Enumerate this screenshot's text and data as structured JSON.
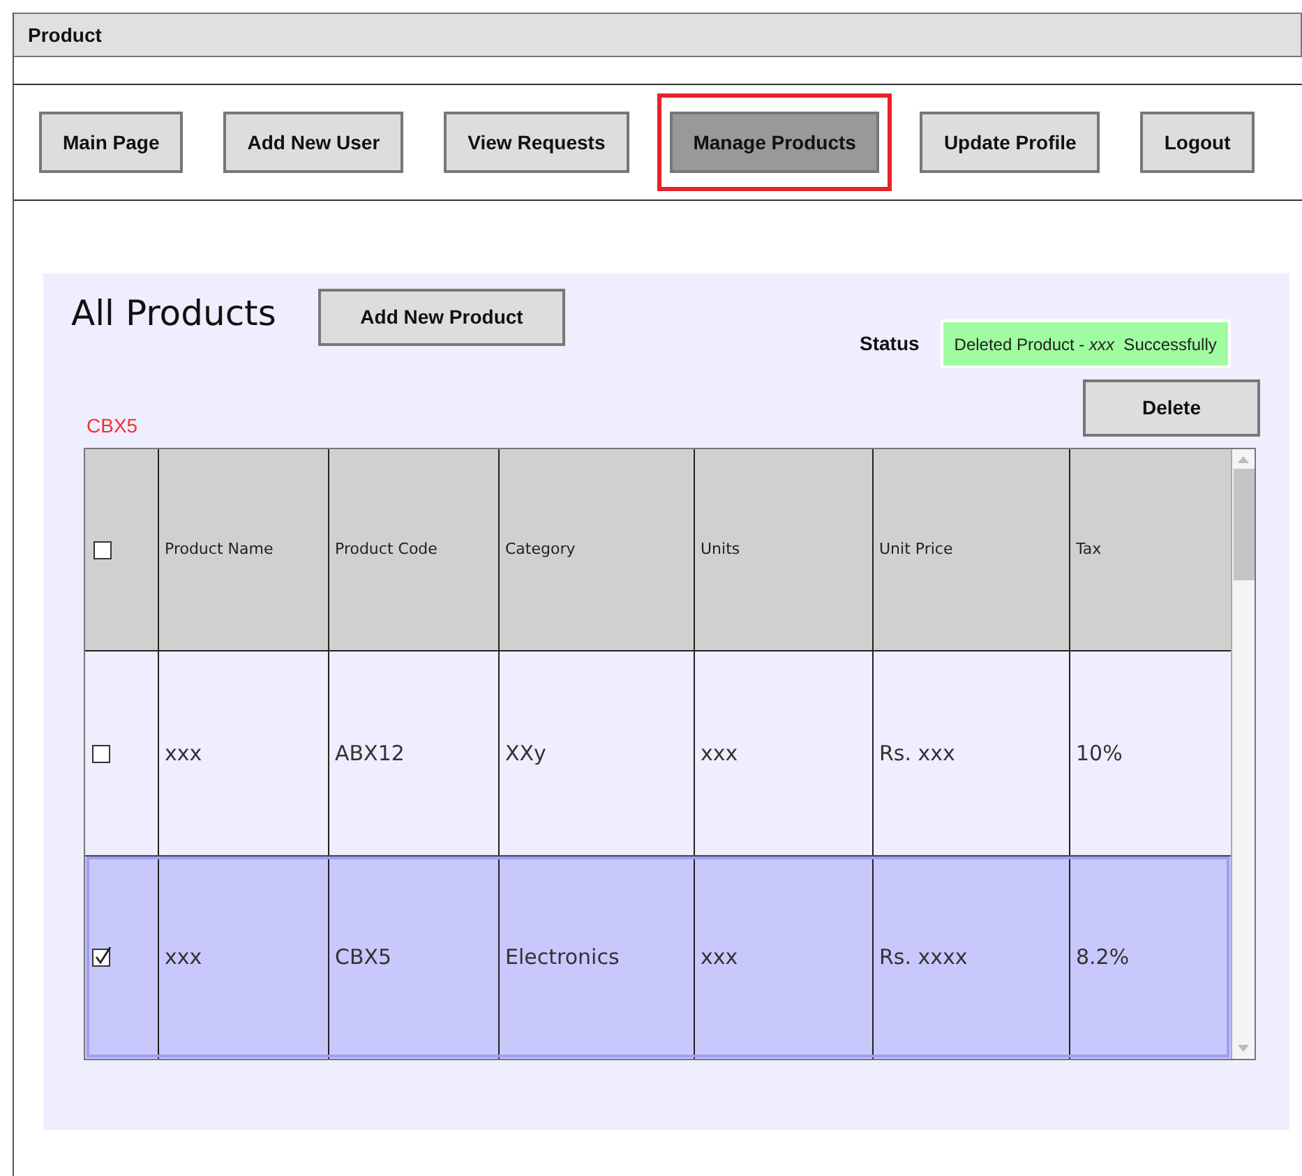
{
  "window": {
    "title": "Product"
  },
  "nav": [
    {
      "label": "Main Page",
      "selected": false
    },
    {
      "label": "Add New User",
      "selected": false
    },
    {
      "label": "View Requests",
      "selected": false
    },
    {
      "label": "Manage Products",
      "selected": true
    },
    {
      "label": "Update Profile",
      "selected": false
    },
    {
      "label": "Logout",
      "selected": false
    }
  ],
  "panel": {
    "title": "All Products",
    "add_button": "Add New Product",
    "status_label": "Status",
    "status_message": "Deleted Product - *xxx*  Successfully",
    "selected_code": "CBX5",
    "delete_button": "Delete"
  },
  "table": {
    "header_checked": false,
    "columns": [
      "Product Name",
      "Product Code",
      "Category",
      "Units",
      "Unit Price",
      "Tax"
    ],
    "rows": [
      {
        "checked": false,
        "selected": false,
        "cells": [
          "xxx",
          "ABX12",
          "XXy",
          "xxx",
          "Rs. xxx",
          "10%"
        ]
      },
      {
        "checked": true,
        "selected": true,
        "cells": [
          "xxx",
          "CBX5",
          "Electronics",
          "xxx",
          "Rs. xxxx",
          "8.2%"
        ]
      }
    ]
  }
}
